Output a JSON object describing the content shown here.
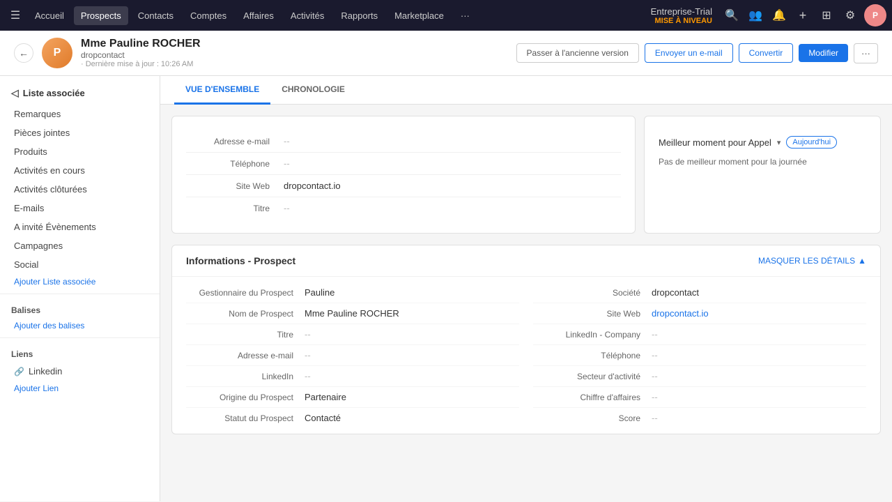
{
  "topnav": {
    "menu_icon": "☰",
    "items": [
      {
        "id": "accueil",
        "label": "Accueil",
        "active": false
      },
      {
        "id": "prospects",
        "label": "Prospects",
        "active": true
      },
      {
        "id": "contacts",
        "label": "Contacts",
        "active": false
      },
      {
        "id": "comptes",
        "label": "Comptes",
        "active": false
      },
      {
        "id": "affaires",
        "label": "Affaires",
        "active": false
      },
      {
        "id": "activites",
        "label": "Activités",
        "active": false
      },
      {
        "id": "rapports",
        "label": "Rapports",
        "active": false
      },
      {
        "id": "marketplace",
        "label": "Marketplace",
        "active": false
      },
      {
        "id": "more",
        "label": "···",
        "active": false
      }
    ],
    "brand": {
      "name": "Entreprise-Trial",
      "upgrade": "MISE À NIVEAU"
    },
    "avatar_initials": "P"
  },
  "header": {
    "back_label": "←",
    "contact_initials": "P",
    "contact_name": "Mme Pauline ROCHER",
    "contact_company": "dropcontact",
    "contact_updated": "· Dernière mise à jour : 10:26 AM",
    "btn_old_version": "Passer à l'ancienne version",
    "btn_email": "Envoyer un e-mail",
    "btn_convert": "Convertir",
    "btn_edit": "Modifier",
    "btn_more": "···"
  },
  "sidebar": {
    "header_label": "Liste associée",
    "items": [
      "Remarques",
      "Pièces jointes",
      "Produits",
      "Activités en cours",
      "Activités clôturées",
      "E-mails",
      "A invité Évènements",
      "Campagnes",
      "Social"
    ],
    "add_link": "Ajouter Liste associée",
    "section_balises": "Balises",
    "add_balises": "Ajouter des balises",
    "section_liens": "Liens",
    "linkedin_label": "Linkedin",
    "add_lien": "Ajouter Lien"
  },
  "tabs": [
    {
      "id": "overview",
      "label": "VUE D'ENSEMBLE",
      "active": true
    },
    {
      "id": "chronologie",
      "label": "CHRONOLOGIE",
      "active": false
    }
  ],
  "top_card": {
    "fields": [
      {
        "label": "Adresse e-mail",
        "value": "--",
        "empty": true
      },
      {
        "label": "Téléphone",
        "value": "--",
        "empty": true
      },
      {
        "label": "Site Web",
        "value": "dropcontact.io",
        "empty": false
      },
      {
        "label": "Titre",
        "value": "--",
        "empty": true
      }
    ]
  },
  "call_card": {
    "label": "Meilleur moment pour Appel",
    "badge": "Aujourd'hui",
    "dropdown": "▾",
    "note": "Pas de meilleur moment pour la journée"
  },
  "prospect_section": {
    "title": "Informations - Prospect",
    "toggle_label": "MASQUER LES DÉTAILS",
    "toggle_icon": "▲",
    "left_fields": [
      {
        "label": "Gestionnaire du Prospect",
        "value": "Pauline",
        "empty": false,
        "link": false
      },
      {
        "label": "Nom de Prospect",
        "value": "Mme Pauline ROCHER",
        "empty": false,
        "link": false
      },
      {
        "label": "Titre",
        "value": "--",
        "empty": true,
        "link": false
      },
      {
        "label": "Adresse e-mail",
        "value": "--",
        "empty": true,
        "link": false
      },
      {
        "label": "LinkedIn",
        "value": "--",
        "empty": true,
        "link": false
      },
      {
        "label": "Origine du Prospect",
        "value": "Partenaire",
        "empty": false,
        "link": false
      },
      {
        "label": "Statut du Prospect",
        "value": "Contacté",
        "empty": false,
        "link": false
      }
    ],
    "right_fields": [
      {
        "label": "Société",
        "value": "dropcontact",
        "empty": false,
        "link": false
      },
      {
        "label": "Site Web",
        "value": "dropcontact.io",
        "empty": false,
        "link": true
      },
      {
        "label": "LinkedIn - Company",
        "value": "--",
        "empty": true,
        "link": false
      },
      {
        "label": "Téléphone",
        "value": "--",
        "empty": true,
        "link": false
      },
      {
        "label": "Secteur d'activité",
        "value": "--",
        "empty": true,
        "link": false
      },
      {
        "label": "Chiffre d'affaires",
        "value": "--",
        "empty": true,
        "link": false
      },
      {
        "label": "Score",
        "value": "--",
        "empty": true,
        "link": false
      }
    ]
  }
}
